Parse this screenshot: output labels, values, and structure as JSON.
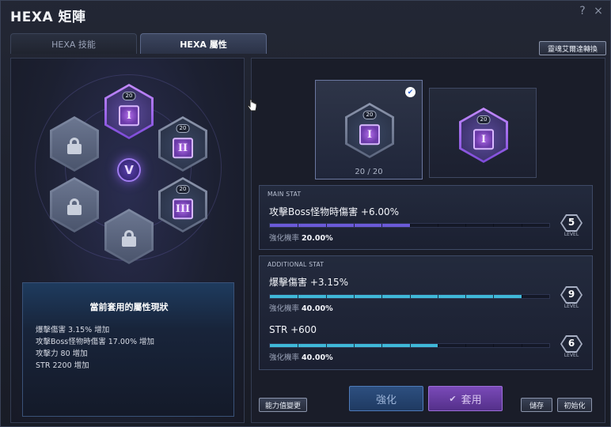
{
  "window": {
    "title": "HEXA 矩陣",
    "help_glyph": "?",
    "close_glyph": "×"
  },
  "tabs": [
    {
      "label": "HEXA 技能",
      "active": false
    },
    {
      "label": "HEXA 屬性",
      "active": true
    }
  ],
  "convert_button": "靈魂艾爾達轉換",
  "matrix": {
    "center_glyph": "V",
    "nodes": [
      {
        "id": "top",
        "state": "selected",
        "level": "20",
        "rune": "I"
      },
      {
        "id": "upper-left",
        "state": "locked"
      },
      {
        "id": "upper-right",
        "state": "active",
        "level": "20",
        "rune": "II"
      },
      {
        "id": "lower-left",
        "state": "locked"
      },
      {
        "id": "lower-right",
        "state": "active",
        "level": "20",
        "rune": "III"
      },
      {
        "id": "bottom",
        "state": "locked"
      }
    ]
  },
  "current_status": {
    "title": "當前套用的屬性現狀",
    "lines": [
      "爆擊傷害 3.15% 增加",
      "攻擊Boss怪物時傷害 17.00% 增加",
      "攻擊力 80 增加",
      "STR 2200 增加"
    ]
  },
  "ability_button": "能力值變更",
  "preview": {
    "cards": [
      {
        "level": "20",
        "rune": "I",
        "selected": true,
        "count_current": "20",
        "count_sep": "/",
        "count_max": "20"
      },
      {
        "level": "20",
        "rune": "I",
        "selected": false
      }
    ],
    "check_glyph": "✔"
  },
  "main_stat": {
    "header": "MAIN STAT",
    "name": "攻擊Boss怪物時傷害 +6.00%",
    "rate_label": "強化機率",
    "rate_value": "20.00%",
    "level": "5",
    "level_label": "LEVEL",
    "progress": 0.5,
    "bar_color": "#6b5ad8"
  },
  "additional_stats": {
    "header": "ADDITIONAL STAT",
    "items": [
      {
        "name": "爆擊傷害 +3.15%",
        "rate_label": "強化機率",
        "rate_value": "40.00%",
        "level": "9",
        "level_label": "LEVEL",
        "progress": 0.9,
        "bar_color": "#3fb8d8"
      },
      {
        "name": "STR +600",
        "rate_label": "強化機率",
        "rate_value": "40.00%",
        "level": "6",
        "level_label": "LEVEL",
        "progress": 0.6,
        "bar_color": "#3fb8d8"
      }
    ]
  },
  "buttons": {
    "enhance": "強化",
    "apply": "套用",
    "apply_icon": "✔",
    "save": "儲存",
    "reset": "初始化"
  }
}
